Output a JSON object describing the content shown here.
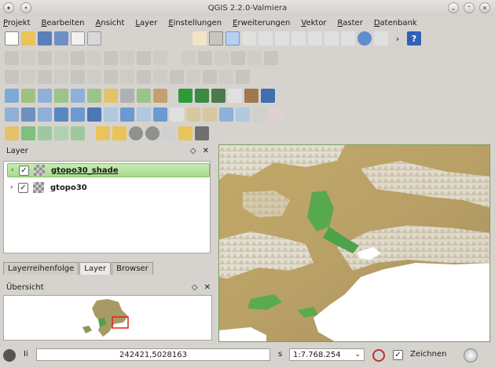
{
  "window": {
    "title": "QGIS 2.2.0-Valmiera"
  },
  "menu": [
    "Projekt",
    "Bearbeiten",
    "Ansicht",
    "Layer",
    "Einstellungen",
    "Erweiterungen",
    "Vektor",
    "Raster",
    "Datenbank"
  ],
  "layers_panel": {
    "title": "Layer",
    "layers": [
      {
        "name": "gtopo30_shade",
        "checked": true,
        "selected": true
      },
      {
        "name": "gtopo30",
        "checked": true,
        "selected": false
      }
    ]
  },
  "tabs": [
    {
      "label": "Layerreihenfolge",
      "active": false
    },
    {
      "label": "Layer",
      "active": true
    },
    {
      "label": "Browser",
      "active": false
    }
  ],
  "overview_panel": {
    "title": "Übersicht"
  },
  "statusbar": {
    "coord_label": "Ii",
    "coordinate": "242421,5028163",
    "scale_label": "s",
    "scale": "1:7.768.254",
    "render_label": "Zeichnen",
    "render_checked": true
  },
  "colors": {
    "selection": "#a9dc8f",
    "extent_box": "#e02020",
    "land": "#b09a5a",
    "lowland": "#4ea24b"
  }
}
